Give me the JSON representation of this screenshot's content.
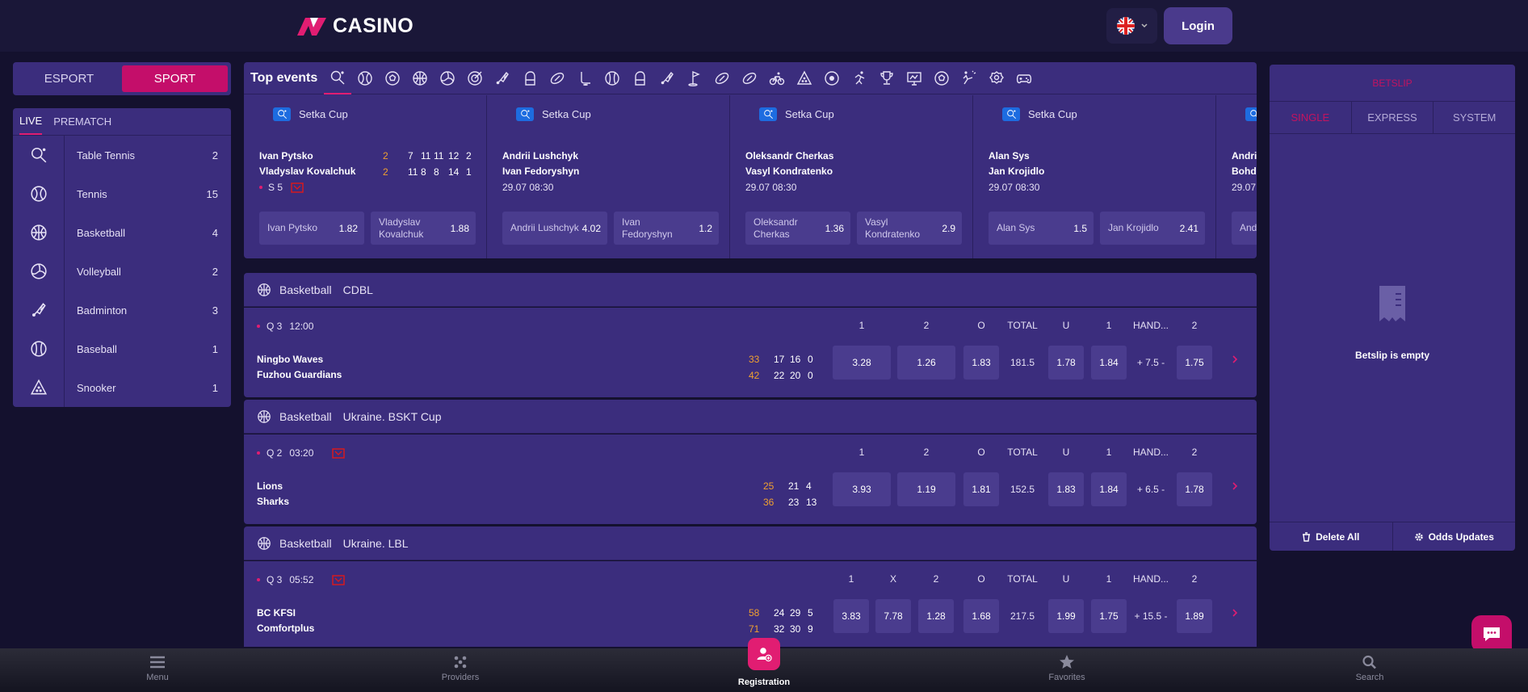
{
  "header": {
    "logo_text": "CASINO",
    "login_label": "Login"
  },
  "mode_toggle": {
    "esport": "ESPORT",
    "sport": "SPORT"
  },
  "sidebar": {
    "tabs": {
      "live": "LIVE",
      "prematch": "PREMATCH"
    },
    "items": [
      {
        "name": "Table Tennis",
        "count": "2",
        "icon": "table-tennis-icon"
      },
      {
        "name": "Tennis",
        "count": "15",
        "icon": "tennis-icon"
      },
      {
        "name": "Basketball",
        "count": "4",
        "icon": "basketball-icon"
      },
      {
        "name": "Volleyball",
        "count": "2",
        "icon": "volleyball-icon"
      },
      {
        "name": "Badminton",
        "count": "3",
        "icon": "badminton-icon"
      },
      {
        "name": "Baseball",
        "count": "1",
        "icon": "baseball-icon"
      },
      {
        "name": "Snooker",
        "count": "1",
        "icon": "snooker-icon"
      }
    ]
  },
  "top_events": {
    "title": "Top events",
    "cards": [
      {
        "league": "Setka Cup",
        "p1": "Ivan Pytsko",
        "p2": "Vladyslav Kovalchuk",
        "s1": [
          "2",
          "7",
          "11",
          "11",
          "12",
          "2"
        ],
        "s2": [
          "2",
          "11",
          "8",
          "8",
          "14",
          "1"
        ],
        "set": "S 5",
        "o1n": "Ivan Pytsko",
        "o1v": "1.82",
        "o2n": "Vladyslav Kovalchuk",
        "o2v": "1.88"
      },
      {
        "league": "Setka Cup",
        "p1": "Andrii Lushchyk",
        "p2": "Ivan Fedoryshyn",
        "date": "29.07   08:30",
        "o1n": "Andrii Lushchyk",
        "o1v": "4.02",
        "o2n": "Ivan Fedoryshyn",
        "o2v": "1.2"
      },
      {
        "league": "Setka Cup",
        "p1": "Oleksandr Cherkas",
        "p2": "Vasyl Kondratenko",
        "date": "29.07   08:30",
        "o1n": "Oleksandr Cherkas",
        "o1v": "1.36",
        "o2n": "Vasyl Kondratenko",
        "o2v": "2.9"
      },
      {
        "league": "Setka Cup",
        "p1": "Alan Sys",
        "p2": "Jan Krojidlo",
        "date": "29.07   08:30",
        "o1n": "Alan Sys",
        "o1v": "1.5",
        "o2n": "Jan Krojidlo",
        "o2v": "2.41"
      },
      {
        "league": "",
        "p1": "Andri",
        "p2": "Bohd",
        "date": "29.07",
        "o1n": "And"
      }
    ]
  },
  "matches": [
    {
      "sport": "Basketball",
      "league": "CDBL",
      "period": "Q 3",
      "time": "12:00",
      "team1": "Ningbo Waves",
      "team2": "Fuzhou Guardians",
      "score1": [
        "33",
        "17",
        "16",
        "0"
      ],
      "score2": [
        "42",
        "22",
        "20",
        "0"
      ],
      "headers": [
        "1",
        "2",
        "O",
        "TOTAL",
        "U",
        "1",
        "HAND...",
        "2"
      ],
      "odds": [
        "3.28",
        "1.26",
        "1.83",
        "181.5",
        "1.78",
        "1.84",
        "+ 7.5 -",
        "1.75"
      ]
    },
    {
      "sport": "Basketball",
      "league": "Ukraine. BSKT Cup",
      "period": "Q 2",
      "time": "03:20",
      "team1": "Lions",
      "team2": "Sharks",
      "score1": [
        "25",
        "21",
        "4"
      ],
      "score2": [
        "36",
        "23",
        "13"
      ],
      "headers": [
        "1",
        "2",
        "O",
        "TOTAL",
        "U",
        "1",
        "HAND...",
        "2"
      ],
      "odds": [
        "3.93",
        "1.19",
        "1.81",
        "152.5",
        "1.83",
        "1.84",
        "+ 6.5 -",
        "1.78"
      ]
    },
    {
      "sport": "Basketball",
      "league": "Ukraine. LBL",
      "period": "Q 3",
      "time": "05:52",
      "team1": "BC KFSI",
      "team2": "Comfortplus",
      "score1": [
        "58",
        "24",
        "29",
        "5"
      ],
      "score2": [
        "71",
        "32",
        "30",
        "9"
      ],
      "headers": [
        "1",
        "X",
        "2",
        "O",
        "TOTAL",
        "U",
        "1",
        "HAND...",
        "2"
      ],
      "odds": [
        "3.83",
        "7.78",
        "1.28",
        "1.68",
        "217.5",
        "1.99",
        "1.75",
        "+ 15.5 -",
        "1.89"
      ]
    }
  ],
  "betslip": {
    "title": "BETSLIP",
    "tabs": [
      "SINGLE",
      "EXPRESS",
      "SYSTEM"
    ],
    "empty": "Betslip is empty",
    "delete_all": "Delete All",
    "odds_updates": "Odds Updates"
  },
  "bottom_nav": {
    "menu": "Menu",
    "providers": "Providers",
    "registration": "Registration",
    "favorites": "Favorites",
    "search": "Search"
  },
  "colors": {
    "accent": "#e11d72",
    "panel": "#3b2d7d",
    "bg": "#14112e",
    "score_live": "#f0a030"
  }
}
